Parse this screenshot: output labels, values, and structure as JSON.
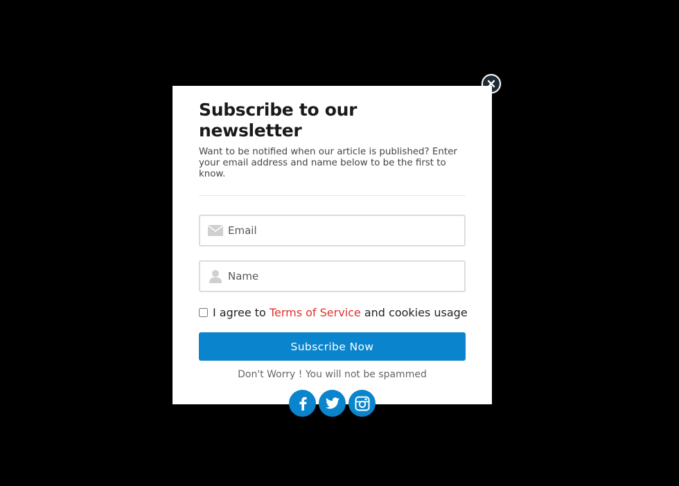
{
  "colors": {
    "backdrop": "#000000",
    "modal_bg": "#ffffff",
    "primary": "#0a84cc",
    "link": "#e0302b",
    "close_bg": "#1f2a33"
  },
  "modal": {
    "title": "Subscribe to our newsletter",
    "description": "Want to be notified when our article is published? Enter your email address and name below to be the first to know.",
    "email_field": {
      "placeholder": "Email",
      "value": "",
      "icon": "envelope-icon"
    },
    "name_field": {
      "placeholder": "Name",
      "value": "",
      "icon": "user-icon"
    },
    "agree": {
      "checked": false,
      "prefix": "I agree to ",
      "link_text": "Terms of Service",
      "suffix": " and cookies usage"
    },
    "submit_label": "Subscribe Now",
    "note": "Don't Worry ! You will not be spammed",
    "socials": [
      "facebook-icon",
      "twitter-icon",
      "instagram-icon"
    ],
    "close_icon": "close-icon"
  }
}
